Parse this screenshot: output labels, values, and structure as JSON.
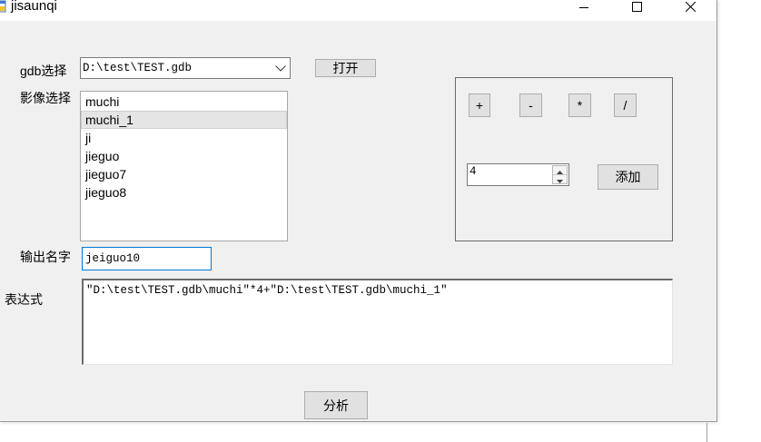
{
  "window": {
    "title": "jisaunqi"
  },
  "form": {
    "gdb_label": "gdb选择",
    "gdb_path": "D:\\test\\TEST.gdb",
    "open_button": "打开",
    "image_label": "影像选择",
    "image_list": {
      "items": [
        "muchi",
        "muchi_1",
        "ji",
        "jieguo",
        "jieguo7",
        "jieguo8"
      ],
      "selected_index": 1
    },
    "output_label": "输出名字",
    "output_name": "jeiguo10",
    "expression_label": "表达式",
    "expression": "\"D:\\test\\TEST.gdb\\muchi\"*4+\"D:\\test\\TEST.gdb\\muchi_1\"",
    "analyze_button": "分析"
  },
  "operators": {
    "buttons": [
      "+",
      "-",
      "*",
      "/"
    ],
    "number_value": "4",
    "add_button": "添加"
  },
  "icons": {
    "app": "app-icon",
    "minimize": "minimize-icon",
    "maximize": "maximize-icon",
    "close": "close-icon",
    "dropdown": "chevron-down-icon",
    "spin_up": "spin-up-icon",
    "spin_down": "spin-down-icon"
  },
  "colors": {
    "window_bg": "#f0f0f0",
    "titlebar_bg": "#ffffff",
    "button_bg": "#e1e1e1",
    "focus_border": "#0078d7",
    "selection_bg": "#e5e5e5"
  }
}
